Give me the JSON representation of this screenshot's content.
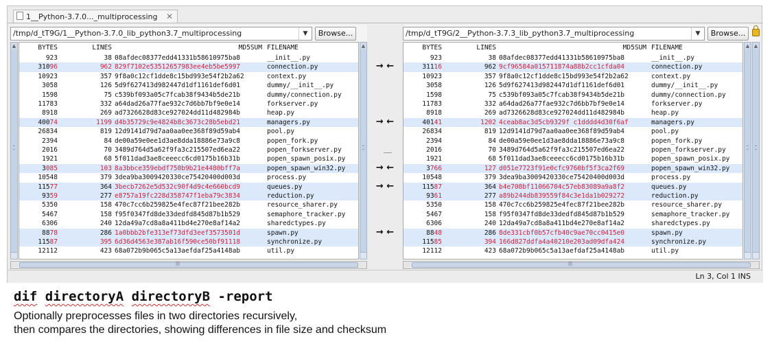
{
  "tab": {
    "title": "1__Python-3.7.0..._multiprocessing",
    "close_icon": "✕"
  },
  "browse_label": "Browse...",
  "left": {
    "path": "/tmp/d_tT9G/1__Python-3.7.0_lib_python3.7_multiprocessing",
    "rows": [
      {
        "bytes": "923",
        "lines": "38",
        "md5": "08afdec08377edd41331b58610975ba8",
        "name": "__init__.py",
        "diff": false
      },
      {
        "bytes": "31096",
        "lines": "962",
        "md5": "829f7102e53512657983ee4eb5be5997",
        "name": "connection.py",
        "diff": true,
        "bytesSplit": 3,
        "linesRed": true,
        "md5Red": true
      },
      {
        "bytes": "10923",
        "lines": "357",
        "md5": "9f8a0c12cf1dde8c15bd993e54f2b2a62",
        "name": "context.py",
        "diff": false
      },
      {
        "bytes": "3058",
        "lines": "126",
        "md5": "5d9f627413d982447d1df1161def6d01",
        "name": "dummy/__init__.py",
        "diff": false
      },
      {
        "bytes": "1598",
        "lines": "75",
        "md5": "c539bf093a05c7fcab38f9434b5de21b",
        "name": "dummy/connection.py",
        "diff": false
      },
      {
        "bytes": "11783",
        "lines": "332",
        "md5": "a64dad26a77fae932c7d6bb7bf9e0e14",
        "name": "forkserver.py",
        "diff": false
      },
      {
        "bytes": "8918",
        "lines": "269",
        "md5": "ad7326628d83ce927024dd11d482984b",
        "name": "heap.py",
        "diff": false
      },
      {
        "bytes": "40074",
        "lines": "1199",
        "md5": "d4b35729c9e4824b8c3673c28b5ebd21",
        "name": "managers.py",
        "diff": true,
        "bytesSplit": 3,
        "linesRed": true,
        "md5Red": true
      },
      {
        "bytes": "26834",
        "lines": "819",
        "md5": "12d9141d79d7aa0aa0ee368f89d59ab4",
        "name": "pool.py",
        "diff": false
      },
      {
        "bytes": "2394",
        "lines": "84",
        "md5": "de00a59e0ee1d3ae8dda18886e73a9c8",
        "name": "popen_fork.py",
        "diff": false
      },
      {
        "bytes": "2016",
        "lines": "70",
        "md5": "3489d764d5a62f9fa3c215507ed6ea22",
        "name": "popen_forkserver.py",
        "diff": false
      },
      {
        "bytes": "1921",
        "lines": "68",
        "md5": "5f011dad3ae8ceeecc6cd0175b16b31b",
        "name": "popen_spawn_posix.py",
        "diff": false
      },
      {
        "bytes": "3085",
        "lines": "103",
        "md5": "8a3bbce359ebdf750b9b21e4480bff7a",
        "name": "popen_spawn_win32.py",
        "diff": true,
        "bytesSplit": 1,
        "linesRed": true,
        "md5Red": true
      },
      {
        "bytes": "10548",
        "lines": "379",
        "md5": "3dea9ba3009420330ce75420400d003d",
        "name": "process.py",
        "diff": false
      },
      {
        "bytes": "11577",
        "lines": "364",
        "md5": "3becb7262e5d532c90f4d9c4e660bcd9",
        "name": "queues.py",
        "diff": true,
        "bytesSplit": 3,
        "linesRed": false,
        "md5Red": true
      },
      {
        "bytes": "9359",
        "lines": "277",
        "md5": "e8757a19fc228d358747f1eba79c3834",
        "name": "reduction.py",
        "diff": true,
        "bytesSplit": 2,
        "linesRed": false,
        "md5Red": true
      },
      {
        "bytes": "5350",
        "lines": "158",
        "md5": "470c7cc6b259825e4fec87f21bee282b",
        "name": "resource_sharer.py",
        "diff": false
      },
      {
        "bytes": "5467",
        "lines": "158",
        "md5": "f95f0347fd8de33dedfd845d87b1b529",
        "name": "semaphore_tracker.py",
        "diff": false
      },
      {
        "bytes": "6306",
        "lines": "240",
        "md5": "12da49a7cd8a8a411bd4e270e8af14a2",
        "name": "sharedctypes.py",
        "diff": false
      },
      {
        "bytes": "8878",
        "lines": "286",
        "md5": "1a0bbb2bfe313ef73dfd3eef3573501d",
        "name": "spawn.py",
        "diff": true,
        "bytesSplit": 2,
        "linesRed": false,
        "md5Red": true
      },
      {
        "bytes": "11587",
        "lines": "395",
        "md5": "6d36d4563e387ab16f590ce50bf91118",
        "name": "synchronize.py",
        "diff": true,
        "bytesSplit": 3,
        "linesRed": true,
        "md5Red": true
      },
      {
        "bytes": "12112",
        "lines": "423",
        "md5": "68a072b9b065c5a13aefdaf25a4148ab",
        "name": "util.py",
        "diff": false
      }
    ]
  },
  "right": {
    "path": "/tmp/d_tT9G/2__Python-3.7.3_lib_python3.7_multiprocessing",
    "rows": [
      {
        "bytes": "923",
        "lines": "38",
        "md5": "08afdec08377edd41331b58610975ba8",
        "name": "__init__.py",
        "diff": false
      },
      {
        "bytes": "31116",
        "lines": "962",
        "md5": "9cf96584a015711874a88b2cc1cfda04",
        "name": "connection.py",
        "diff": true,
        "bytesSplit": 3,
        "linesRed": false,
        "md5Red": true
      },
      {
        "bytes": "10923",
        "lines": "357",
        "md5": "9f8a0c12cf1dde8c15bd993e54f2b2a62",
        "name": "context.py",
        "diff": false
      },
      {
        "bytes": "3058",
        "lines": "126",
        "md5": "5d9f627413d982447d1df1161def6d01",
        "name": "dummy/__init__.py",
        "diff": false
      },
      {
        "bytes": "1598",
        "lines": "75",
        "md5": "c539bf093a05c7fcab38f9434b5de21b",
        "name": "dummy/connection.py",
        "diff": false
      },
      {
        "bytes": "11783",
        "lines": "332",
        "md5": "a64dad26a77fae932c7d6bb7bf9e0e14",
        "name": "forkserver.py",
        "diff": false
      },
      {
        "bytes": "8918",
        "lines": "269",
        "md5": "ad7326628d83ce927024dd11d482984b",
        "name": "heap.py",
        "diff": false
      },
      {
        "bytes": "40141",
        "lines": "1202",
        "md5": "4ceab8ac3d5cb9329f c1dddd4d30f6af",
        "name": "managers.py",
        "diff": true,
        "bytesSplit": 3,
        "linesRed": true,
        "md5Red": true
      },
      {
        "bytes": "26834",
        "lines": "819",
        "md5": "12d9141d79d7aa0aa0ee368f89d59ab4",
        "name": "pool.py",
        "diff": false
      },
      {
        "bytes": "2394",
        "lines": "84",
        "md5": "de00a59e0ee1d3ae8dda18886e73a9c8",
        "name": "popen_fork.py",
        "diff": false
      },
      {
        "bytes": "2016",
        "lines": "70",
        "md5": "3489d764d5a62f9fa3c215507ed6ea22",
        "name": "popen_forkserver.py",
        "diff": false
      },
      {
        "bytes": "1921",
        "lines": "68",
        "md5": "5f011dad3ae8ceeecc6cd0175b16b31b",
        "name": "popen_spawn_posix.py",
        "diff": false
      },
      {
        "bytes": "3766",
        "lines": "127",
        "md5": "d051e7723f91e0cfc9760bf5f3ca2f69",
        "name": "popen_spawn_win32.py",
        "diff": true,
        "bytesSplit": 1,
        "linesRed": true,
        "md5Red": true
      },
      {
        "bytes": "10548",
        "lines": "379",
        "md5": "3dea9ba3009420330ce75420400d003d",
        "name": "process.py",
        "diff": false
      },
      {
        "bytes": "11587",
        "lines": "364",
        "md5": "b4e708bf11066704c57eb83089a9a8f2",
        "name": "queues.py",
        "diff": true,
        "bytesSplit": 3,
        "linesRed": false,
        "md5Red": true
      },
      {
        "bytes": "9361",
        "lines": "277",
        "md5": "a89b244db839559f84c3e1da1b029272",
        "name": "reduction.py",
        "diff": true,
        "bytesSplit": 2,
        "linesRed": false,
        "md5Red": true
      },
      {
        "bytes": "5350",
        "lines": "158",
        "md5": "470c7cc6b259825e4fec87f21bee282b",
        "name": "resource_sharer.py",
        "diff": false
      },
      {
        "bytes": "5467",
        "lines": "158",
        "md5": "f95f0347fd8de33dedfd845d87b1b529",
        "name": "semaphore_tracker.py",
        "diff": false
      },
      {
        "bytes": "6306",
        "lines": "240",
        "md5": "12da49a7cd8a8a411bd4e270e8af14a2",
        "name": "sharedctypes.py",
        "diff": false
      },
      {
        "bytes": "8848",
        "lines": "286",
        "md5": "8de331cbf0b57cfb40c9ae70cc0415e0",
        "name": "spawn.py",
        "diff": true,
        "bytesSplit": 2,
        "linesRed": false,
        "md5Red": true
      },
      {
        "bytes": "11585",
        "lines": "394",
        "md5": "166d827ddfa4a40210e203ad09dfa424",
        "name": "synchronize.py",
        "diff": true,
        "bytesSplit": 3,
        "linesRed": true,
        "md5Red": true
      },
      {
        "bytes": "12112",
        "lines": "423",
        "md5": "68a072b9b065c5a13aefdaf25a4148ab",
        "name": "util.py",
        "diff": false
      }
    ]
  },
  "columns": {
    "bytes": "BYTES",
    "lines": "LINES",
    "md5": "MD5SUM",
    "filename": "FILENAME"
  },
  "arrows": [
    {
      "row": 1,
      "text": "→ ←"
    },
    {
      "row": 7,
      "text": "→ ←"
    },
    {
      "row": 12,
      "text": "→ ←"
    },
    {
      "row": 14,
      "text": "→ ←"
    },
    {
      "row": 19,
      "text": "→ ←"
    }
  ],
  "status": "Ln 3, Col 1 INS",
  "caption": {
    "title_words": [
      "dif",
      "directoryA",
      "directoryB",
      "-report"
    ],
    "line1": "Optionally preprocesses files in two directories recursively,",
    "line2": "then compares the directories, showing differences in file size and checksum"
  },
  "colors": {
    "diff_row": "#dce9fb",
    "diff_text": "#d4203a"
  }
}
